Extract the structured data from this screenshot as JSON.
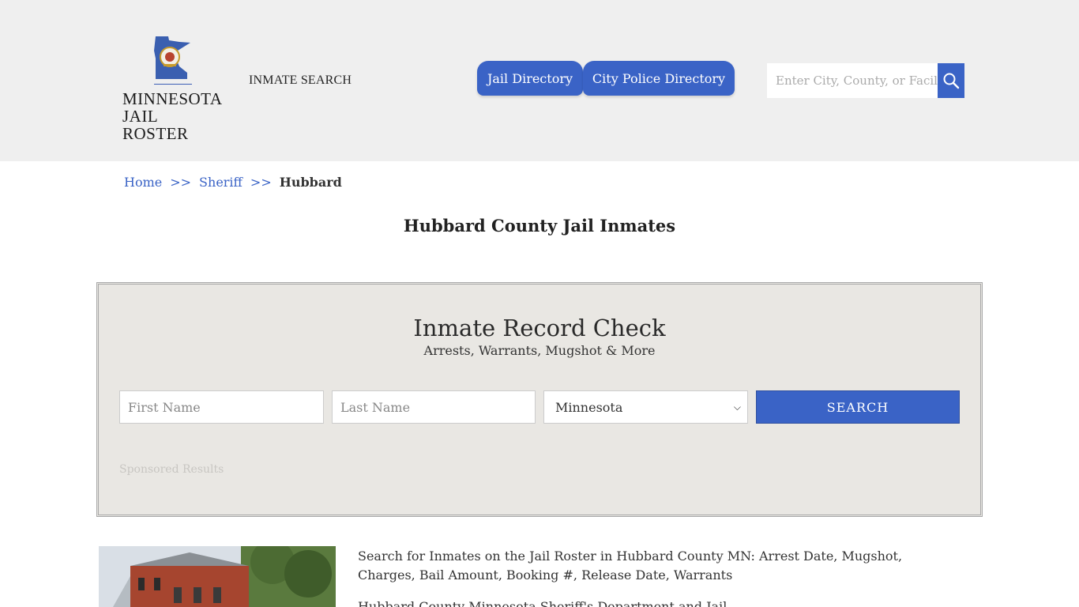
{
  "header": {
    "logo_line1": "MINNESOTA",
    "logo_line2": "JAIL ROSTER",
    "inmate_search": "INMATE SEARCH",
    "tabs": [
      {
        "label": "Jail Directory"
      },
      {
        "label": "City Police Directory"
      }
    ],
    "search": {
      "placeholder": "Enter City, County, or Facil",
      "icon": "magnifier-icon"
    }
  },
  "breadcrumb": {
    "home": "Home",
    "sep": ">>",
    "sheriff": "Sheriff",
    "current": "Hubbard"
  },
  "page_title": "Hubbard County Jail Inmates",
  "record_check": {
    "title": "Inmate Record Check",
    "subtitle": "Arrests, Warrants, Mugshot & More",
    "first_name_placeholder": "First Name",
    "last_name_placeholder": "Last Name",
    "state_selected": "Minnesota",
    "search_label": "SEARCH",
    "sponsored": "Sponsored Results"
  },
  "content": {
    "intro": "Search for Inmates on the Jail Roster in Hubbard County MN: Arrest Date, Mugshot, Charges, Bail Amount, Booking #, Release Date, Warrants",
    "second_line": "Hubbard County Minnesota Sheriff's Department and Jail"
  },
  "colors": {
    "accent": "#3a63c6",
    "header_bg": "#efefef",
    "box_bg": "#e9e7e3"
  }
}
